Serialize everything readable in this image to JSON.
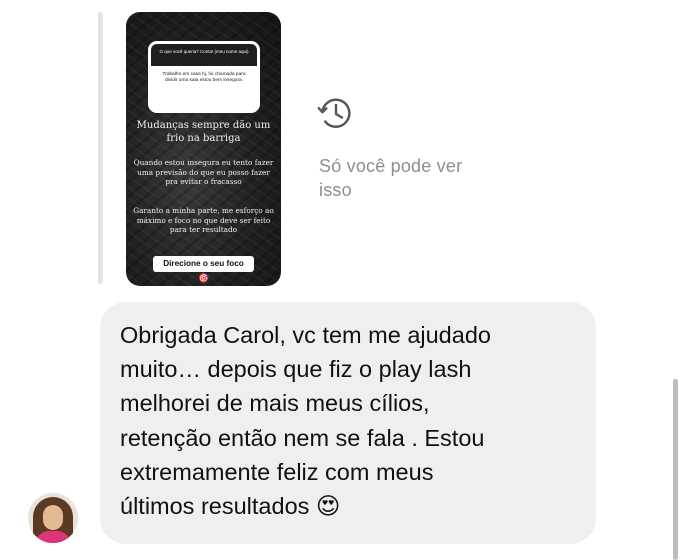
{
  "story": {
    "question_header": "O que você queria? Conta! (meu nome aqui)",
    "question_body": "Trabalho em casa hj, fui chamada para dividir uma sala estou bem insegura.",
    "title": "Mudanças sempre dão um frio na barriga",
    "paragraph1": "Quando estou insegura eu tento fazer uma previsão do que eu posso fazer pra evitar o fracasso",
    "paragraph2": "Garanto a minha parte, me esforço ao máximo e foco no que deve ser feito para ter resultado",
    "button_label": "Direcione o seu foco",
    "sticker": "🎯"
  },
  "notice": {
    "icon": "history-icon",
    "text": "Só você pode ver isso"
  },
  "message": {
    "text": "Obrigada Carol, vc tem me ajudado\nmuito… depois que fiz o play lash\nmelhorei de mais meus cílios,\nretenção então nem se fala . Estou\nextremamente feliz com meus\núltimos resultados 😍"
  },
  "colors": {
    "bubble": "#efefef",
    "notice_text": "#8e8e8e",
    "reply_bar": "#e3e3e3",
    "avatar_shirt": "#e0347a"
  }
}
